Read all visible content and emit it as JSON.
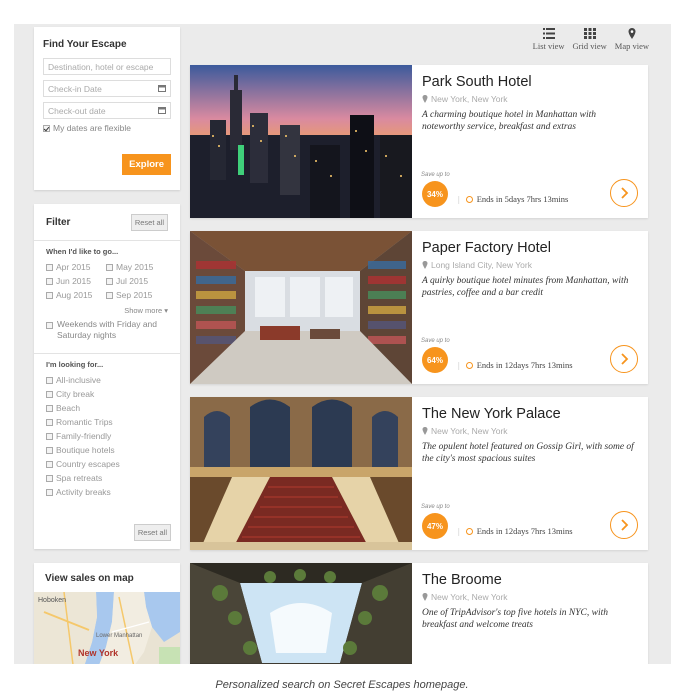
{
  "views": {
    "list": "List view",
    "grid": "Grid view",
    "map": "Map view"
  },
  "search": {
    "title": "Find Your Escape",
    "destination_placeholder": "Destination, hotel or escape",
    "checkin_placeholder": "Check-in Date",
    "checkout_placeholder": "Check-out date",
    "flexible_label": "My dates are flexible",
    "flexible_checked": true,
    "explore_label": "Explore"
  },
  "filter": {
    "title": "Filter",
    "reset_label": "Reset all",
    "when_heading": "When I'd like to go...",
    "months": [
      "Apr 2015",
      "May 2015",
      "Jun 2015",
      "Jul 2015",
      "Aug 2015",
      "Sep 2015"
    ],
    "show_more": "Show more",
    "weekends_label": "Weekends with Friday and Saturday nights",
    "looking_heading": "I'm looking for...",
    "looking_options": [
      "All-inclusive",
      "City break",
      "Beach",
      "Romantic Trips",
      "Family-friendly",
      "Boutique hotels",
      "Country escapes",
      "Spa retreats",
      "Activity breaks"
    ],
    "reset_bottom": "Reset all"
  },
  "map": {
    "title": "View sales on map",
    "labels": [
      "Hoboken",
      "Lower Manhattan",
      "New York"
    ]
  },
  "cards": [
    {
      "title": "Park South Hotel",
      "location": "New York, New York",
      "description": "A charming boutique hotel in Manhattan with noteworthy service, breakfast and extras",
      "save_label": "Save up to",
      "discount": "34%",
      "ends": "Ends in 5days 7hrs 13mins"
    },
    {
      "title": "Paper Factory Hotel",
      "location": "Long Island City, New York",
      "description": "A quirky boutique hotel minutes from Manhattan, with pastries, coffee and a bar credit",
      "save_label": "Save up to",
      "discount": "64%",
      "ends": "Ends in 12days 7hrs 13mins"
    },
    {
      "title": "The New York Palace",
      "location": "New York, New York",
      "description": "The opulent hotel featured on Gossip Girl, with some of the city's most spacious suites",
      "save_label": "Save up to",
      "discount": "47%",
      "ends": "Ends in 12days 7hrs 13mins"
    },
    {
      "title": "The Broome",
      "location": "New York, New York",
      "description": "One of TripAdvisor's top five hotels in NYC, with breakfast and welcome treats"
    }
  ],
  "caption": "Personalized search on Secret Escapes homepage.",
  "colors": {
    "accent": "#f7941d",
    "background": "#ebebeb"
  }
}
